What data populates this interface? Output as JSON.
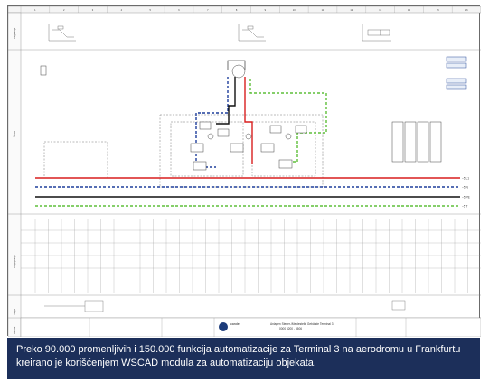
{
  "figure": {
    "column_numbers": [
      "1",
      "2",
      "3",
      "4",
      "5",
      "6",
      "7",
      "8",
      "9",
      "10",
      "11",
      "12",
      "13",
      "14",
      "15",
      "16"
    ],
    "side_labels": [
      "Regulacija",
      "Šema",
      "Dodjeljivanje",
      "Struja",
      "Adresa"
    ],
    "title_block": {
      "company": "cander",
      "project_line1": "Anlagen Steuer-/Meldestelle Gebäude Terminal 3",
      "project_line2": "0000 5200 - 5506"
    },
    "bus_labels": [
      "~5 L1",
      "~5 N",
      "~5 PE",
      "~5 T"
    ]
  },
  "caption": {
    "line1": "Preko 90.000 promenljivih i 150.000 funkcija automatizacije za Terminal 3 na aerodromu u Frankfurtu",
    "line2": "kreirano je korišćenjem WSCAD modula za automatizaciju objekata."
  },
  "colors": {
    "caption_bg": "#1c2f5a",
    "red_line": "#d81e1e",
    "blue_line": "#1f3e9c",
    "green_line": "#5fbf3a",
    "black_line": "#111111"
  }
}
